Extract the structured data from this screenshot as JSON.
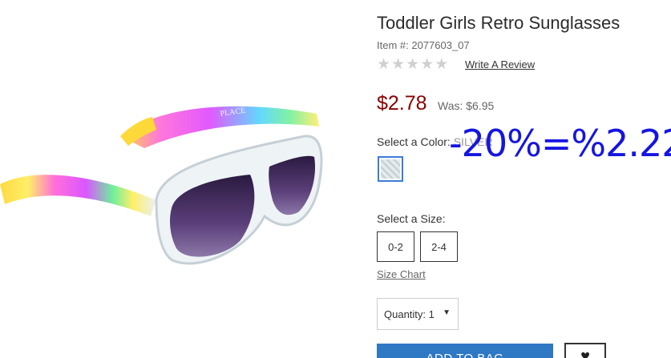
{
  "product": {
    "title": "Toddler Girls Retro Sunglasses",
    "item_number": "Item #: 2077603_07",
    "rating_stars": 5,
    "rating_filled": 0,
    "write_review_label": "Write A Review",
    "price": "$2.78",
    "was_price": "Was: $6.95"
  },
  "color": {
    "label": "Select a Color: ",
    "selected": "SILVER",
    "swatch_name": "silver-glitter"
  },
  "overlay_annotation": "-20%=%2.22",
  "size": {
    "label": "Select a Size:",
    "options": [
      "0-2",
      "2-4"
    ],
    "chart_link": "Size Chart"
  },
  "quantity": {
    "label": "Quantity:",
    "value": "1"
  },
  "actions": {
    "add_to_bag": "ADD TO BAG",
    "wishlist_icon": "heart-icon"
  },
  "colors": {
    "price": "#8b0000",
    "accent_blue": "#2e78c4",
    "overlay_blue": "#1515e0"
  }
}
